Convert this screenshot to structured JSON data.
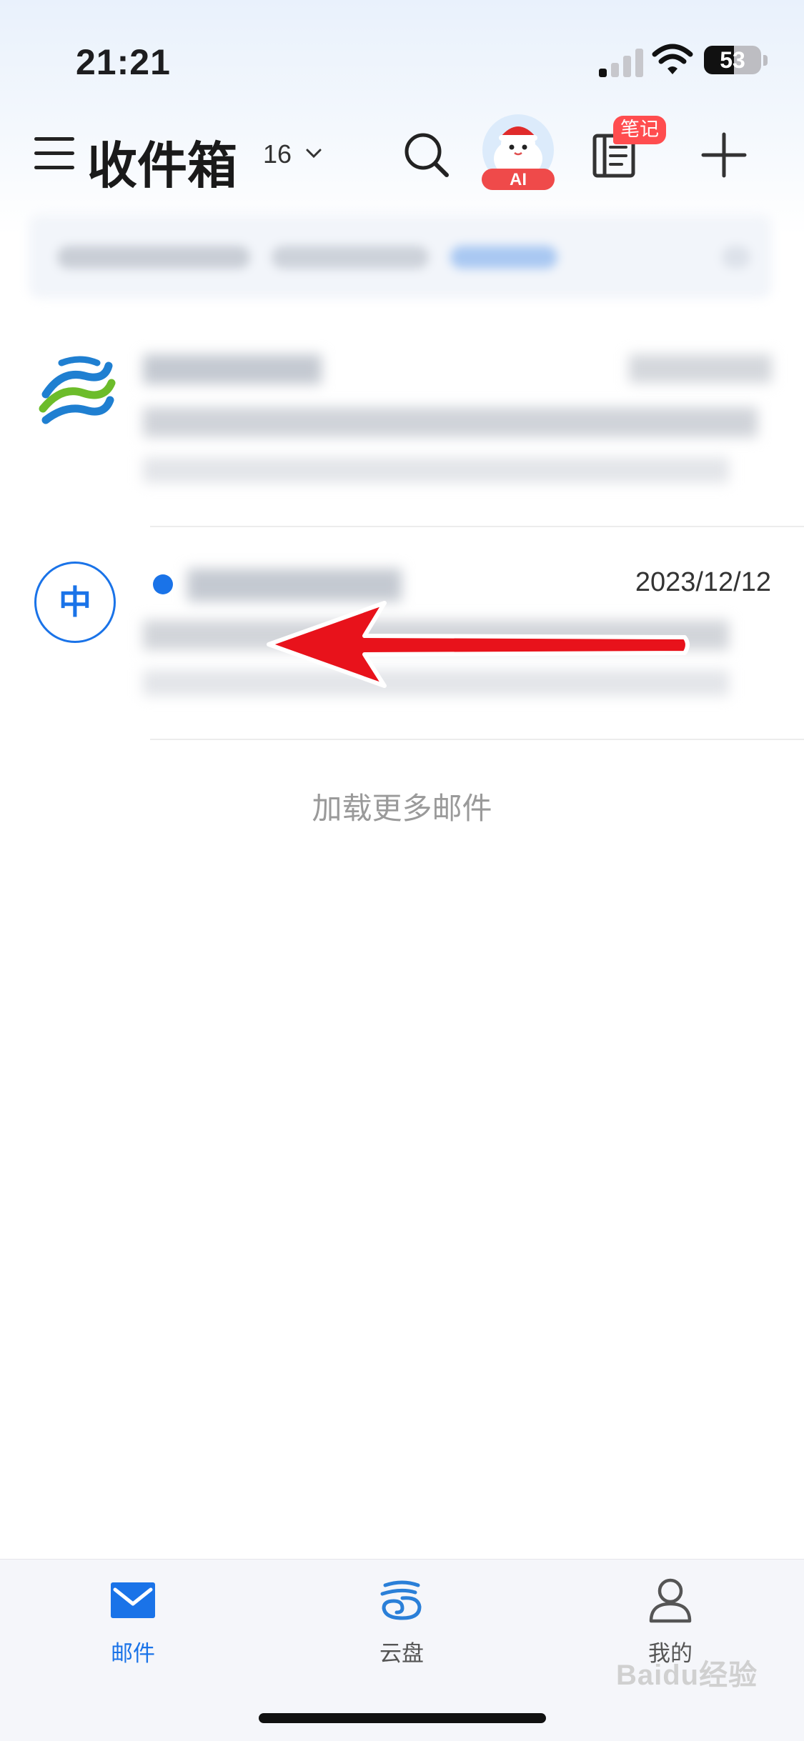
{
  "status_bar": {
    "time": "21:21",
    "battery": "53",
    "battery_level": 0.53
  },
  "header": {
    "title": "收件箱",
    "count": "16",
    "ai_badge": "AI",
    "notes_badge": "笔记",
    "icons": [
      "menu-icon",
      "chevron-down-icon",
      "search-icon",
      "ai-assistant-avatar",
      "notes-icon",
      "add-icon"
    ]
  },
  "mail_list": [
    {
      "avatar": "china-mobile-logo",
      "unread": false,
      "date": ""
    },
    {
      "avatar_letter": "中",
      "unread": true,
      "date": "2023/12/12"
    }
  ],
  "load_more": "加载更多邮件",
  "annotation": {
    "type": "swipe-left-arrow",
    "color": "#e8121b"
  },
  "tab_bar": {
    "tabs": [
      {
        "label": "邮件",
        "icon": "mail-icon",
        "active": true
      },
      {
        "label": "云盘",
        "icon": "cloud-drive-icon",
        "active": false
      },
      {
        "label": "我的",
        "icon": "profile-icon",
        "active": false
      }
    ]
  },
  "watermark": "Baidu经验",
  "colors": {
    "accent": "#1a73e8",
    "badge": "#ff4d4f",
    "arrow": "#e8121b"
  }
}
